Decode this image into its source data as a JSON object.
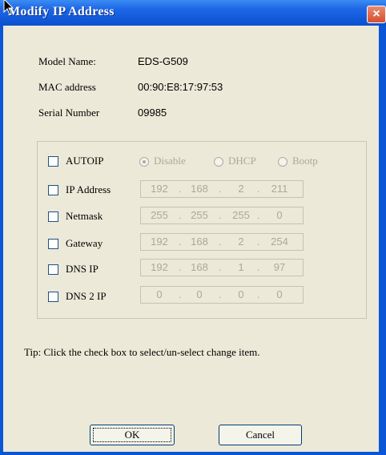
{
  "window": {
    "title": "Modify IP Address",
    "close_glyph": "×",
    "accent_color": "#0a56d6"
  },
  "info": [
    {
      "label": "Model Name:",
      "value": "EDS-G509"
    },
    {
      "label": "MAC address",
      "value": "00:90:E8:17:97:53"
    },
    {
      "label": "Serial Number",
      "value": "09985"
    }
  ],
  "autoip": {
    "label": "AUTOIP",
    "checked": false,
    "options": [
      {
        "label": "Disable",
        "selected": true
      },
      {
        "label": "DHCP",
        "selected": false
      },
      {
        "label": "Bootp",
        "selected": false
      }
    ]
  },
  "fields": [
    {
      "label": "IP Address",
      "checked": false,
      "octets": [
        "192",
        "168",
        "2",
        "211"
      ]
    },
    {
      "label": "Netmask",
      "checked": false,
      "octets": [
        "255",
        "255",
        "255",
        "0"
      ]
    },
    {
      "label": "Gateway",
      "checked": false,
      "octets": [
        "192",
        "168",
        "2",
        "254"
      ]
    },
    {
      "label": "DNS IP",
      "checked": false,
      "octets": [
        "192",
        "168",
        "1",
        "97"
      ]
    },
    {
      "label": "DNS 2 IP",
      "checked": false,
      "octets": [
        "0",
        "0",
        "0",
        "0"
      ]
    }
  ],
  "tip": "Tip: Click the check box to select/un-select change item.",
  "buttons": {
    "ok": "OK",
    "cancel": "Cancel"
  }
}
